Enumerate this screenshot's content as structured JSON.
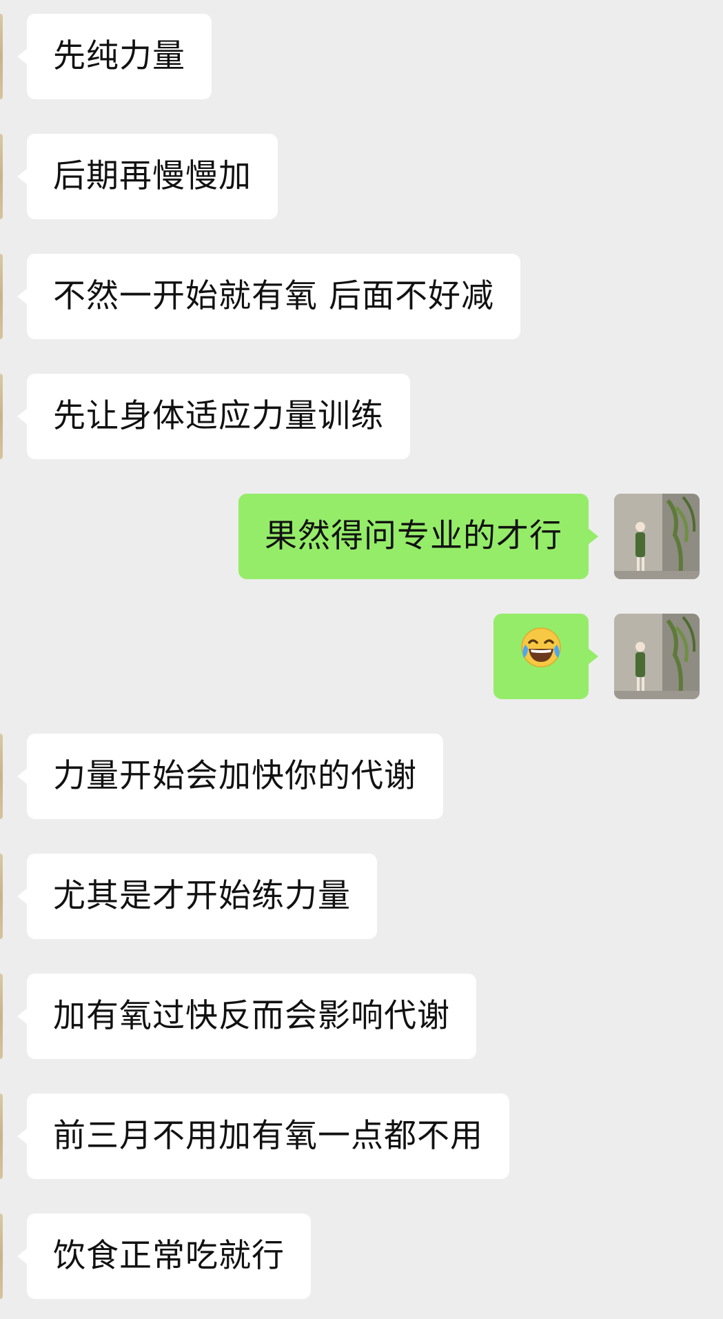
{
  "messages": [
    {
      "side": "in",
      "text": "先纯力量"
    },
    {
      "side": "in",
      "text": "后期再慢慢加"
    },
    {
      "side": "in",
      "text": "不然一开始就有氧 后面不好减"
    },
    {
      "side": "in",
      "text": "先让身体适应力量训练"
    },
    {
      "side": "out",
      "text": "果然得问专业的才行"
    },
    {
      "side": "out",
      "emoji": "face-with-tears-of-joy"
    },
    {
      "side": "in",
      "text": "力量开始会加快你的代谢"
    },
    {
      "side": "in",
      "text": "尤其是才开始练力量"
    },
    {
      "side": "in",
      "text": "加有氧过快反而会影响代谢"
    },
    {
      "side": "in",
      "text": "前三月不用加有氧一点都不用"
    },
    {
      "side": "in",
      "text": "饮食正常吃就行"
    }
  ],
  "colors": {
    "background": "#ededed",
    "incoming_bubble": "#ffffff",
    "outgoing_bubble": "#95ec69",
    "text": "#111111"
  }
}
